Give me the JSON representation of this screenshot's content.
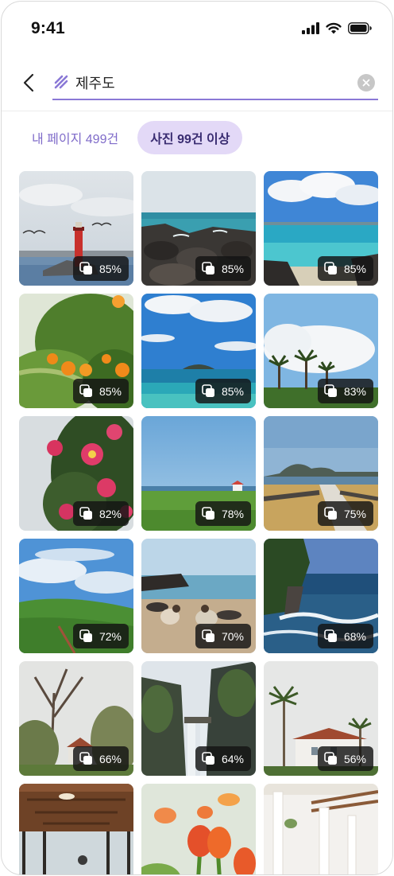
{
  "status_bar": {
    "time": "9:41"
  },
  "search": {
    "query": "제주도"
  },
  "filters": [
    {
      "label": "내 페이지 499건",
      "active": false
    },
    {
      "label": "사진 99건 이상",
      "active": true
    }
  ],
  "photos": [
    {
      "scene": "lighthouse-harbor",
      "match": "85%"
    },
    {
      "scene": "rocky-coast",
      "match": "85%"
    },
    {
      "scene": "turquoise-beach",
      "match": "85%"
    },
    {
      "scene": "tangerine-tree",
      "match": "85%"
    },
    {
      "scene": "island-sea",
      "match": "85%"
    },
    {
      "scene": "palm-trees",
      "match": "83%"
    },
    {
      "scene": "camellia-flowers",
      "match": "82%"
    },
    {
      "scene": "green-field-sea",
      "match": "78%"
    },
    {
      "scene": "stone-wall-path",
      "match": "75%"
    },
    {
      "scene": "green-hill-sky",
      "match": "72%"
    },
    {
      "scene": "beach-people",
      "match": "70%"
    },
    {
      "scene": "cliff-waves",
      "match": "68%"
    },
    {
      "scene": "bare-trees-house",
      "match": "66%"
    },
    {
      "scene": "waterfall",
      "match": "64%"
    },
    {
      "scene": "palm-villa",
      "match": "56%"
    },
    {
      "scene": "train-interior",
      "match": ""
    },
    {
      "scene": "tulips",
      "match": ""
    },
    {
      "scene": "white-colonnade",
      "match": ""
    }
  ]
}
